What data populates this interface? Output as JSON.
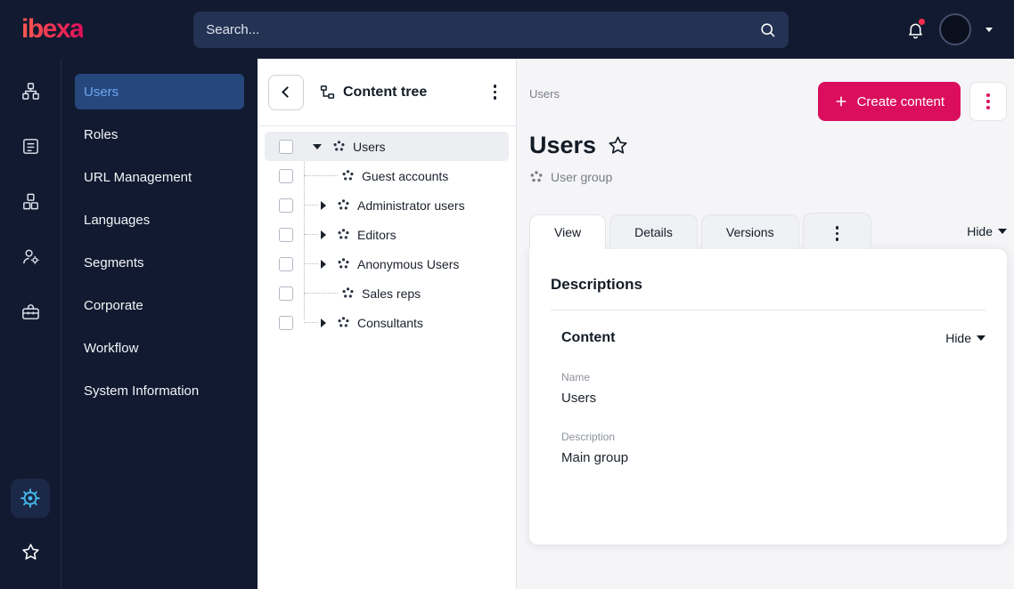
{
  "topbar": {
    "logo_text": "ibexa",
    "search_placeholder": "Search..."
  },
  "sidebar": {
    "items": [
      {
        "label": "Users",
        "active": true
      },
      {
        "label": "Roles",
        "active": false
      },
      {
        "label": "URL Management",
        "active": false
      },
      {
        "label": "Languages",
        "active": false
      },
      {
        "label": "Segments",
        "active": false
      },
      {
        "label": "Corporate",
        "active": false
      },
      {
        "label": "Workflow",
        "active": false
      },
      {
        "label": "System Information",
        "active": false
      }
    ]
  },
  "content_tree": {
    "title": "Content tree",
    "rows": [
      {
        "label": "Users",
        "level": 0,
        "expanded": true,
        "selected": true
      },
      {
        "label": "Guest accounts",
        "level": 1,
        "leaf": true
      },
      {
        "label": "Administrator users",
        "level": 1,
        "collapsed": true
      },
      {
        "label": "Editors",
        "level": 1,
        "collapsed": true
      },
      {
        "label": "Anonymous Users",
        "level": 1,
        "collapsed": true
      },
      {
        "label": "Sales reps",
        "level": 1,
        "leaf": true
      },
      {
        "label": "Consultants",
        "level": 1,
        "collapsed": true
      }
    ]
  },
  "main": {
    "breadcrumb": "Users",
    "create_button_label": "Create content",
    "page_title": "Users",
    "content_type": "User group",
    "tabs": [
      {
        "label": "View",
        "active": true
      },
      {
        "label": "Details",
        "active": false
      },
      {
        "label": "Versions",
        "active": false
      }
    ],
    "hide_label": "Hide",
    "card": {
      "heading": "Descriptions",
      "section_title": "Content",
      "section_hide_label": "Hide",
      "fields": [
        {
          "label": "Name",
          "value": "Users"
        },
        {
          "label": "Description",
          "value": "Main group"
        }
      ]
    }
  },
  "colors": {
    "accent_magenta": "#db0e5e",
    "dark_navy": "#111a30",
    "active_menu_bg": "#25477c",
    "active_menu_text": "#6fa8f5",
    "active_gear": "#45b9ea"
  }
}
